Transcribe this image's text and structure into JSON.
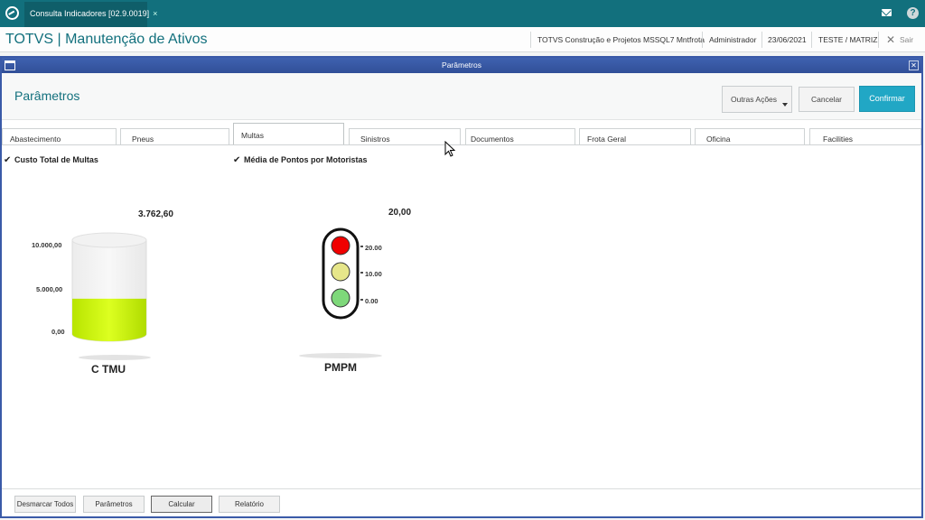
{
  "app_tab": {
    "label": "Consulta Indicadores [02.9.0019]",
    "close": "×"
  },
  "header": {
    "title": "TOTVS | Manutenção de Ativos",
    "environment": "TOTVS Construção e Projetos MSSQL7 Mntfrota",
    "user": "Administrador",
    "date": "23/06/2021",
    "branch": "TESTE / MATRIZ",
    "exit_label": "Sair"
  },
  "dialog": {
    "window_title": "Parâmetros",
    "heading": "Parâmetros",
    "actions": {
      "more": "Outras Ações",
      "cancel": "Cancelar",
      "confirm": "Confirmar"
    }
  },
  "tabs": [
    {
      "label": "Abastecimento"
    },
    {
      "label": "Pneus"
    },
    {
      "label": "Multas"
    },
    {
      "label": "Sinistros"
    },
    {
      "label": "Documentos"
    },
    {
      "label": "Frota Geral"
    },
    {
      "label": "Oficina"
    },
    {
      "label": "Facilities"
    }
  ],
  "active_tab": "Multas",
  "checkboxes": [
    {
      "label": "Custo Total de Multas",
      "checked": true
    },
    {
      "label": "Média de Pontos por Motoristas",
      "checked": true
    }
  ],
  "chart_data": [
    {
      "type": "gauge-cylinder",
      "title": "C TMU",
      "value_label": "3.762,60",
      "value": 3762.6,
      "ticks": [
        "10.000,00",
        "5.000,00",
        "0,00"
      ],
      "range": [
        0,
        10000
      ],
      "fill_color": "#c8f000"
    },
    {
      "type": "traffic-light",
      "title": "PMPM",
      "value_label": "20,00",
      "value": 20,
      "ticks": [
        "20.00",
        "10.00",
        "0.00"
      ],
      "lights": [
        {
          "color": "#f00000"
        },
        {
          "color": "#e6e68a"
        },
        {
          "color": "#7ed87a"
        }
      ]
    }
  ],
  "footer": {
    "buttons": [
      "Desmarcar Todos",
      "Parâmetros",
      "Calcular",
      "Relatório"
    ]
  }
}
